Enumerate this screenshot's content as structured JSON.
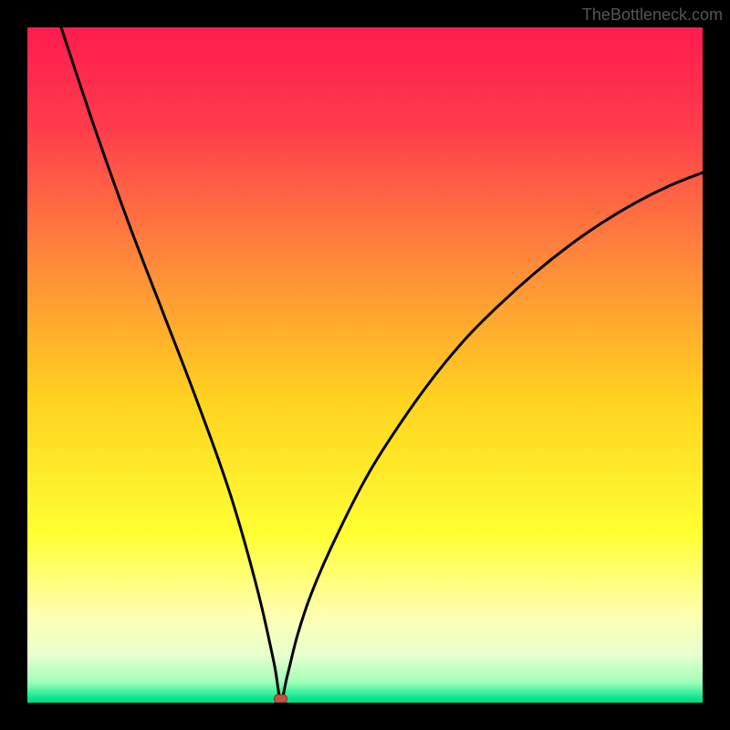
{
  "attribution": "TheBottleneck.com",
  "colors": {
    "frame": "#000000",
    "curve": "#000000",
    "marker_fill": "#c94f3f",
    "marker_stroke": "#8a2f22",
    "gradient_stops": [
      {
        "offset": 0.0,
        "color": "#ff1b4e"
      },
      {
        "offset": 0.15,
        "color": "#ff3d4c"
      },
      {
        "offset": 0.35,
        "color": "#ff8a3a"
      },
      {
        "offset": 0.55,
        "color": "#ffd21f"
      },
      {
        "offset": 0.75,
        "color": "#ffff33"
      },
      {
        "offset": 0.87,
        "color": "#ffffb0"
      },
      {
        "offset": 0.93,
        "color": "#e8ffcf"
      },
      {
        "offset": 0.97,
        "color": "#9effb8"
      },
      {
        "offset": 0.995,
        "color": "#00e58a"
      },
      {
        "offset": 1.0,
        "color": "#00dd88"
      }
    ]
  },
  "chart_data": {
    "type": "line",
    "title": "",
    "xlabel": "",
    "ylabel": "",
    "xlim": [
      0,
      100
    ],
    "ylim": [
      0,
      100
    ],
    "grid": false,
    "legend": false,
    "annotations": [],
    "axis_ticks_visible": false,
    "marker": {
      "x": 37.5,
      "y": 0.5
    },
    "series": [
      {
        "name": "curve",
        "x": [
          5,
          10,
          15,
          20,
          25,
          30,
          34,
          36.5,
          37.5,
          38.5,
          40,
          42,
          45,
          50,
          55,
          60,
          65,
          70,
          75,
          80,
          85,
          90,
          95,
          100
        ],
        "y": [
          100,
          85,
          71,
          58,
          45,
          31,
          17,
          6,
          0.5,
          4,
          10,
          16,
          23,
          33,
          41,
          48,
          54,
          59,
          63.5,
          67.5,
          71,
          74,
          76.5,
          78.5
        ]
      }
    ]
  }
}
